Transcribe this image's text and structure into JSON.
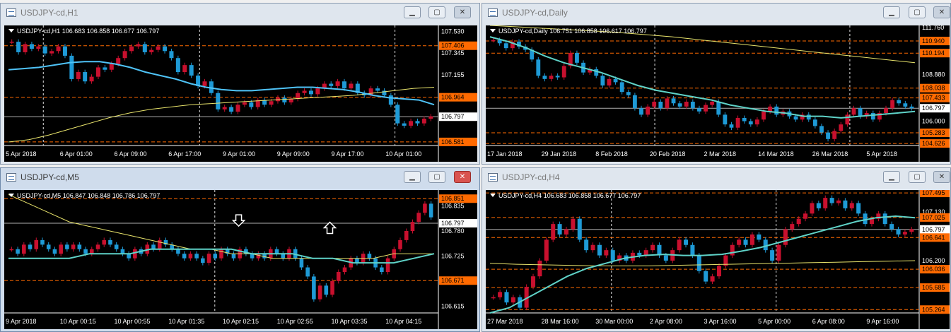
{
  "colors": {
    "bull": "#c8102e",
    "bear": "#1e9ad6",
    "ma_fast": "#4fc3f7",
    "ma_fast_alt": "#5fd3c8",
    "ma_slow": "#e8e36b",
    "hline": "#ff6a00",
    "vline": "#e0e0e0",
    "cur_line": "#b0b0b0",
    "axis_text": "#ffffff"
  },
  "panels": [
    {
      "id": "h1",
      "title": "USDJPY-cd,H1",
      "info": "USDJPY-cd,H1  106.683 106.858 106.677 106.797",
      "state": "inactive",
      "ma_fast_color": "#4fc3f7",
      "ylim": [
        106.55,
        107.58
      ],
      "ticks": [
        "107.530",
        "107.345",
        "107.155",
        "106.964",
        "106.797",
        "106.581"
      ],
      "tick_vals": [
        107.53,
        107.345,
        107.155,
        106.964,
        106.797,
        106.581
      ],
      "price_labels": [
        {
          "text": "107.406",
          "val": 107.406,
          "kind": "orange"
        },
        {
          "text": "106.964",
          "val": 106.964,
          "kind": "orange"
        },
        {
          "text": "106.797",
          "val": 106.797,
          "kind": "current"
        },
        {
          "text": "106.581",
          "val": 106.581,
          "kind": "orange"
        }
      ],
      "hlines": [
        107.406,
        106.964,
        106.581
      ],
      "vlines": [
        0.09,
        0.45,
        0.9
      ],
      "xlabels": [
        "5 Apr 2018",
        "6 Apr 01:00",
        "6 Apr 09:00",
        "6 Apr 17:00",
        "9 Apr 01:00",
        "9 Apr 09:00",
        "9 Apr 17:00",
        "10 Apr 01:00"
      ],
      "closes": [
        107.44,
        107.35,
        107.42,
        107.38,
        107.4,
        107.34,
        107.36,
        107.4,
        107.32,
        107.12,
        107.18,
        107.1,
        107.14,
        107.22,
        107.2,
        107.25,
        107.3,
        107.36,
        107.4,
        107.42,
        107.35,
        107.37,
        107.4,
        107.36,
        107.3,
        107.18,
        107.24,
        107.15,
        107.06,
        107.1,
        107.0,
        106.86,
        106.88,
        106.84,
        106.9,
        106.92,
        106.88,
        106.94,
        106.9,
        106.93,
        106.96,
        106.92,
        106.95,
        107.0,
        107.02,
        106.99,
        107.04,
        107.08,
        107.06,
        107.1,
        107.04,
        107.08,
        107.0,
        106.98,
        107.04,
        107.02,
        106.98,
        106.9,
        106.74,
        106.72,
        106.76,
        106.74,
        106.78,
        106.8
      ],
      "ma_fast": [
        107.2,
        107.21,
        107.22,
        107.24,
        107.26,
        107.27,
        107.27,
        107.25,
        107.22,
        107.18,
        107.15,
        107.12,
        107.08,
        107.05,
        107.03,
        107.02,
        107.02,
        107.03,
        107.04,
        107.05,
        107.05,
        107.04,
        107.03,
        107.01,
        106.98,
        106.96,
        106.95,
        106.94,
        106.9
      ],
      "ma_slow": [
        106.58,
        106.6,
        106.64,
        106.69,
        106.74,
        106.79,
        106.83,
        106.86,
        106.88,
        106.9,
        106.91,
        106.92,
        106.93,
        106.94,
        106.95,
        106.96,
        106.97,
        106.98,
        107.0,
        107.02,
        107.04,
        107.05
      ]
    },
    {
      "id": "daily",
      "title": "USDJPY-cd,Daily",
      "info": "USDJPY-cd,Daily  106.751 106.858 106.617 106.797",
      "state": "inactive",
      "ma_fast_color": "#5fd3c8",
      "ylim": [
        104.5,
        111.9
      ],
      "ticks": [
        "111.760",
        "108.880",
        "106.000"
      ],
      "tick_vals": [
        111.76,
        108.88,
        106.0
      ],
      "price_labels": [
        {
          "text": "110.940",
          "val": 110.94,
          "kind": "orange"
        },
        {
          "text": "110.194",
          "val": 110.194,
          "kind": "orange"
        },
        {
          "text": "108.038",
          "val": 108.038,
          "kind": "orange"
        },
        {
          "text": "107.433",
          "val": 107.433,
          "kind": "orange"
        },
        {
          "text": "106.797",
          "val": 106.797,
          "kind": "current"
        },
        {
          "text": "105.283",
          "val": 105.283,
          "kind": "orange"
        },
        {
          "text": "104.626",
          "val": 104.626,
          "kind": "orange"
        }
      ],
      "hlines": [
        110.94,
        110.194,
        108.038,
        107.433,
        105.283,
        104.626
      ],
      "vlines": [
        0.39,
        0.84
      ],
      "xlabels": [
        "17 Jan 2018",
        "29 Jan 2018",
        "8 Feb 2018",
        "20 Feb 2018",
        "2 Mar 2018",
        "14 Mar 2018",
        "26 Mar 2018",
        "5 Apr 2018"
      ],
      "closes": [
        111.0,
        110.8,
        110.5,
        110.9,
        110.6,
        110.4,
        109.8,
        108.8,
        108.6,
        108.8,
        108.7,
        109.4,
        110.2,
        109.6,
        109.0,
        109.2,
        108.8,
        108.2,
        108.6,
        108.4,
        107.8,
        107.6,
        106.8,
        106.4,
        106.9,
        107.2,
        106.8,
        107.4,
        107.1,
        106.9,
        107.2,
        106.8,
        106.6,
        107.0,
        107.2,
        106.4,
        105.8,
        105.6,
        106.2,
        106.0,
        105.8,
        106.1,
        106.6,
        106.9,
        106.4,
        106.6,
        106.3,
        106.1,
        106.4,
        106.1,
        105.7,
        105.3,
        104.9,
        105.4,
        105.8,
        106.4,
        106.8,
        106.3,
        106.5,
        106.1,
        106.5,
        106.8,
        107.3,
        107.1,
        106.9,
        106.8
      ],
      "ma_fast": [
        111.2,
        110.9,
        110.5,
        110.0,
        109.6,
        109.3,
        109.0,
        108.6,
        108.2,
        107.9,
        107.7,
        107.5,
        107.3,
        107.0,
        106.8,
        106.6,
        106.5,
        106.3,
        106.3,
        106.2,
        106.3,
        106.4,
        106.5,
        106.6
      ],
      "ma_slow": [
        111.9,
        111.8,
        111.7,
        111.6,
        111.5,
        111.35,
        111.2,
        111.0,
        110.8,
        110.6,
        110.4,
        110.2,
        110.0,
        109.8,
        109.6
      ]
    },
    {
      "id": "m5",
      "title": "USDJPY-cd,M5",
      "info": "USDJPY-cd,M5  106.847 106.848 106.786 106.797",
      "state": "active",
      "ma_fast_color": "#5fd3c8",
      "ylim": [
        106.6,
        106.87
      ],
      "ticks": [
        "106.835",
        "106.780",
        "106.725",
        "106.615"
      ],
      "tick_vals": [
        106.835,
        106.78,
        106.725,
        106.615
      ],
      "price_labels": [
        {
          "text": "106.851",
          "val": 106.851,
          "kind": "orange"
        },
        {
          "text": "106.797",
          "val": 106.797,
          "kind": "current"
        },
        {
          "text": "106.671",
          "val": 106.671,
          "kind": "orange"
        }
      ],
      "hlines": [
        106.851,
        106.671
      ],
      "vlines": [
        0.485
      ],
      "xlabels": [
        "9 Apr 2018",
        "10 Apr 00:15",
        "10 Apr 00:55",
        "10 Apr 01:35",
        "10 Apr 02:15",
        "10 Apr 02:55",
        "10 Apr 03:35",
        "10 Apr 04:15"
      ],
      "closes": [
        106.74,
        106.73,
        106.75,
        106.74,
        106.76,
        106.75,
        106.74,
        106.73,
        106.75,
        106.74,
        106.75,
        106.74,
        106.73,
        106.74,
        106.75,
        106.76,
        106.75,
        106.74,
        106.73,
        106.72,
        106.74,
        106.73,
        106.75,
        106.74,
        106.76,
        106.75,
        106.74,
        106.73,
        106.72,
        106.73,
        106.72,
        106.71,
        106.73,
        106.72,
        106.74,
        106.73,
        106.72,
        106.74,
        106.73,
        106.72,
        106.73,
        106.72,
        106.74,
        106.73,
        106.72,
        106.74,
        106.72,
        106.7,
        106.68,
        106.63,
        106.66,
        106.64,
        106.67,
        106.69,
        106.7,
        106.72,
        106.71,
        106.73,
        106.72,
        106.7,
        106.69,
        106.72,
        106.74,
        106.76,
        106.78,
        106.8,
        106.82,
        106.84,
        106.81
      ],
      "ma_fast": [
        106.72,
        106.72,
        106.72,
        106.72,
        106.73,
        106.73,
        106.73,
        106.74,
        106.74,
        106.74,
        106.74,
        106.74,
        106.73,
        106.73,
        106.73,
        106.72,
        106.72,
        106.71,
        106.71,
        106.71,
        106.72,
        106.73
      ],
      "ma_slow": [
        106.86,
        106.84,
        106.82,
        106.8,
        106.79,
        106.78,
        106.77,
        106.76,
        106.75,
        106.74,
        106.74,
        106.73,
        106.73,
        106.72,
        106.72,
        106.72,
        106.72,
        106.72,
        106.72,
        106.73,
        106.73,
        106.73
      ]
    },
    {
      "id": "h4",
      "title": "USDJPY-cd,H4",
      "info": "USDJPY-cd,H4  106.683 106.858 106.677 106.797",
      "state": "inactive",
      "ma_fast_color": "#5fd3c8",
      "ylim": [
        105.2,
        107.55
      ],
      "ticks": [
        "107.130",
        "106.200"
      ],
      "tick_vals": [
        107.13,
        106.2
      ],
      "price_labels": [
        {
          "text": "107.495",
          "val": 107.495,
          "kind": "orange"
        },
        {
          "text": "107.025",
          "val": 107.025,
          "kind": "orange"
        },
        {
          "text": "106.797",
          "val": 106.797,
          "kind": "current"
        },
        {
          "text": "106.641",
          "val": 106.641,
          "kind": "orange"
        },
        {
          "text": "106.036",
          "val": 106.036,
          "kind": "orange"
        },
        {
          "text": "105.685",
          "val": 105.685,
          "kind": "orange"
        },
        {
          "text": "105.264",
          "val": 105.264,
          "kind": "orange"
        }
      ],
      "hlines": [
        107.495,
        107.025,
        106.641,
        106.036,
        105.685,
        105.264
      ],
      "vlines": [
        0.29,
        0.67
      ],
      "xlabels": [
        "27 Mar 2018",
        "28 Mar 16:00",
        "30 Mar 00:00",
        "2 Apr 08:00",
        "3 Apr 16:00",
        "5 Apr 00:00",
        "6 Apr 08:00",
        "9 Apr 16:00"
      ],
      "closes": [
        105.5,
        105.6,
        105.4,
        105.5,
        105.3,
        105.7,
        105.9,
        106.2,
        106.6,
        106.9,
        106.7,
        106.8,
        107.0,
        106.6,
        106.4,
        106.5,
        106.3,
        106.4,
        106.2,
        106.3,
        106.2,
        106.35,
        106.3,
        106.4,
        106.5,
        106.3,
        106.2,
        106.4,
        106.6,
        106.5,
        106.3,
        106.0,
        105.8,
        105.9,
        106.1,
        106.3,
        106.5,
        106.6,
        106.5,
        106.7,
        106.6,
        106.4,
        106.2,
        106.5,
        106.8,
        106.9,
        107.0,
        107.1,
        107.3,
        107.2,
        107.4,
        107.3,
        107.35,
        107.2,
        107.3,
        107.1,
        106.9,
        107.0,
        107.1,
        106.9,
        106.8,
        106.7,
        106.75,
        106.8
      ],
      "ma_fast": [
        105.2,
        105.3,
        105.5,
        105.7,
        105.9,
        106.05,
        106.15,
        106.25,
        106.3,
        106.32,
        106.3,
        106.3,
        106.32,
        106.38,
        106.45,
        106.55,
        106.65,
        106.75,
        106.85,
        106.95,
        107.02,
        107.05,
        107.02
      ],
      "ma_slow": [
        106.15,
        106.13,
        106.12,
        106.11,
        106.1,
        106.1,
        106.1,
        106.11,
        106.12,
        106.13,
        106.14,
        106.15,
        106.16,
        106.17,
        106.18,
        106.19,
        106.2
      ]
    }
  ]
}
